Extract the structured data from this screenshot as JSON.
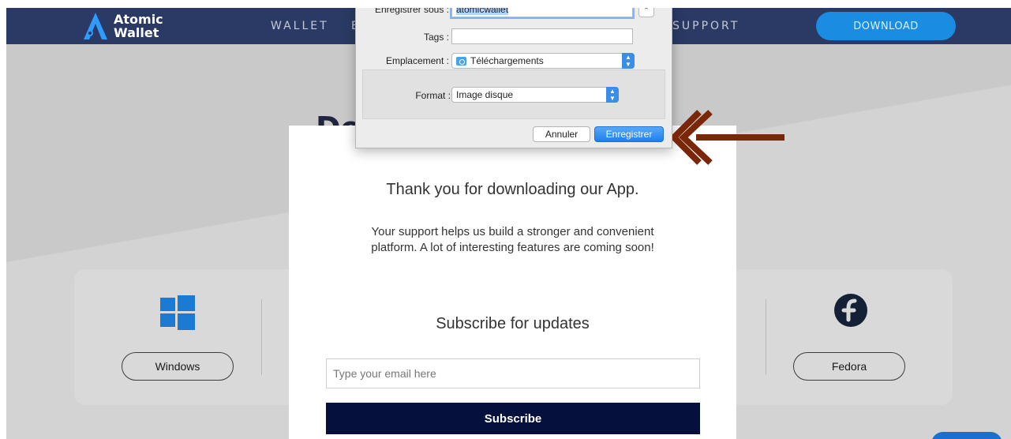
{
  "nav": {
    "logo_line1": "Atomic",
    "logo_line2": "Wallet",
    "links": [
      "WALLET",
      "E",
      "SUPPORT"
    ],
    "download_label": "DOWNLOAD"
  },
  "background": {
    "heading_fragment": "Do",
    "os_buttons": {
      "windows": "Windows",
      "fedora": "Fedora"
    }
  },
  "modal": {
    "close": "×",
    "thanks": "Thank you for downloading our App.",
    "support": "Your support helps us build a stronger and convenient platform. A lot of interesting features are coming soon!",
    "subscribe_title": "Subscribe for updates",
    "email_placeholder": "Type your email here",
    "subscribe_label": "Subscribe"
  },
  "save_dialog": {
    "save_as_label": "Enregistrer sous :",
    "save_as_value": "atomicwallet",
    "tags_label": "Tags :",
    "tags_value": "",
    "location_label": "Emplacement :",
    "location_value": "Téléchargements",
    "format_label": "Format :",
    "format_value": "Image disque",
    "cancel_label": "Annuler",
    "save_label": "Enregistrer"
  },
  "colors": {
    "nav_bg": "#2a3a64",
    "download_btn": "#1a8de3",
    "subscribe_btn": "#06103d",
    "annotation_arrow": "#7a2608",
    "dialog_primary": "#1f7ef0"
  },
  "icons": [
    "atomic-logo-icon",
    "windows-icon",
    "fedora-icon",
    "folder-icon",
    "stepper-icon",
    "arrow-annotation-icon"
  ]
}
